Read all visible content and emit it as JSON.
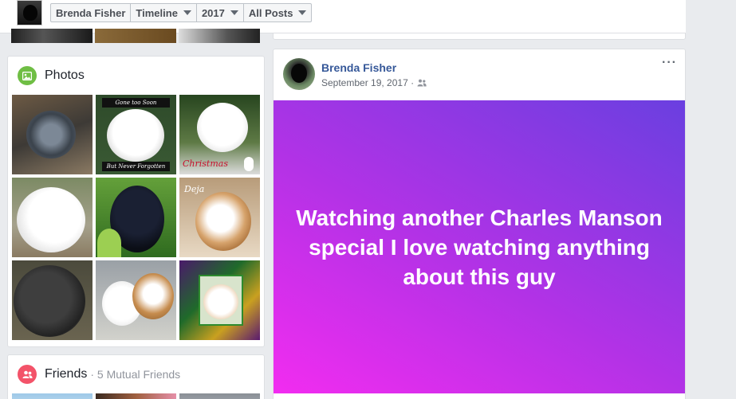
{
  "topbar": {
    "breadcrumbs": [
      {
        "label": "Brenda Fisher",
        "dropdown": false
      },
      {
        "label": "Timeline",
        "dropdown": true
      },
      {
        "label": "2017",
        "dropdown": true
      },
      {
        "label": "All Posts",
        "dropdown": true
      }
    ]
  },
  "photos": {
    "title": "Photos",
    "icon": "photo-icon",
    "accent": "#6fbe44"
  },
  "friends": {
    "title": "Friends",
    "subtitle": "· 5 Mutual Friends",
    "icon": "friends-icon",
    "accent": "#f35369"
  },
  "post": {
    "author": "Brenda Fisher",
    "date": "September 19, 2017 ·",
    "audience_icon": "friends-audience-icon",
    "more_label": "···",
    "status_text": "Watching another Charles Manson special I love watching anything about this guy",
    "gradient_colors": [
      "#f22cf0",
      "#b332e6",
      "#6a3fe0"
    ]
  },
  "colors": {
    "link": "#365899",
    "page_bg": "#e9ebee"
  }
}
